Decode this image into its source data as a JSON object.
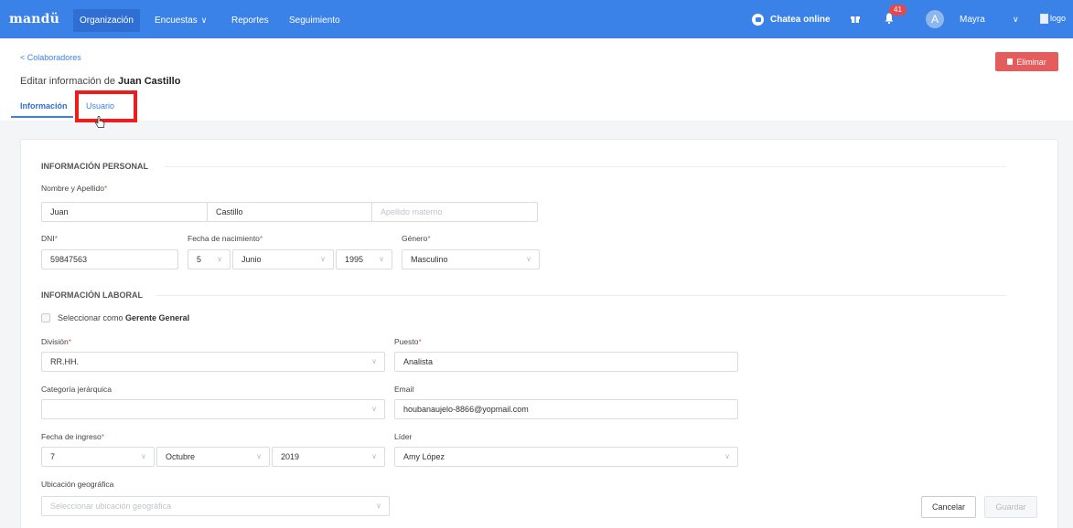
{
  "navbar": {
    "brand": "mandü",
    "items": [
      {
        "label": "Organización",
        "active": true
      },
      {
        "label": "Encuestas",
        "has_dropdown": true
      },
      {
        "label": "Reportes"
      },
      {
        "label": "Seguimiento"
      }
    ],
    "chat_label": "Chatea online",
    "notification_count": "41",
    "avatar_initial": "A",
    "user_name": "Mayra",
    "logo_alt": "logo",
    "accent_color": "#3b82e8"
  },
  "header": {
    "back_link": "< Colaboradores",
    "title_prefix": "Editar información de ",
    "title_name": "Juan Castillo",
    "delete_label": "Eliminar",
    "tabs": [
      {
        "label": "Información",
        "active": true
      },
      {
        "label": "Usuario",
        "active": false
      }
    ]
  },
  "personal": {
    "section_title": "INFORMACIÓN PERSONAL",
    "name_label": "Nombre y Apellido",
    "first_name": "Juan",
    "last_name": "Castillo",
    "maternal_placeholder": "Apellido materno",
    "dni_label": "DNI",
    "dni_value": "59847563",
    "birth_label": "Fecha de nacimiento",
    "birth_day": "5",
    "birth_month": "Junio",
    "birth_year": "1995",
    "gender_label": "Género",
    "gender_value": "Masculino"
  },
  "work": {
    "section_title": "INFORMACIÓN LABORAL",
    "manager_label_prefix": "Seleccionar como ",
    "manager_label_bold": "Gerente General",
    "division_label": "División",
    "division_value": "RR.HH.",
    "position_label": "Puesto",
    "position_value": "Analista",
    "category_label": "Categoría jerárquica",
    "category_value": "",
    "email_label": "Email",
    "email_value": "houbanaujelo-8866@yopmail.com",
    "hire_label": "Fecha de ingreso",
    "hire_day": "7",
    "hire_month": "Octubre",
    "hire_year": "2019",
    "leader_label": "Líder",
    "leader_value": "Amy López",
    "location_label": "Ubicación geográfica",
    "location_placeholder": "Seleccionar ubicación geográfica"
  },
  "actions": {
    "cancel_label": "Cancelar",
    "save_label": "Guardar"
  },
  "required_mark": "*"
}
